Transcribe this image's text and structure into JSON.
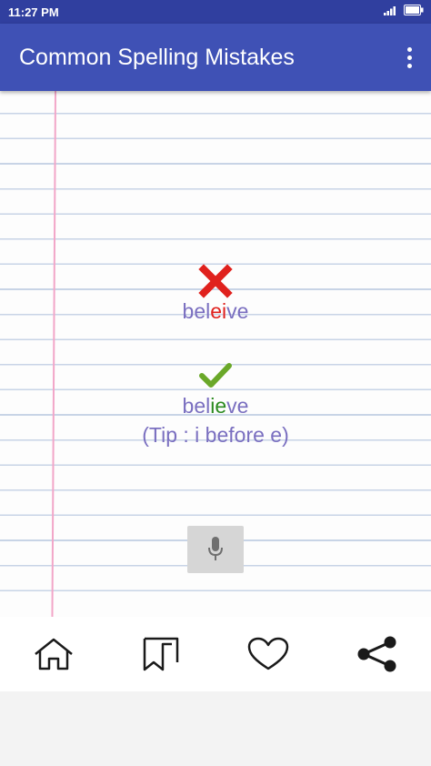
{
  "status_bar": {
    "time": "11:27 PM"
  },
  "app_bar": {
    "title": "Common Spelling Mistakes",
    "overflow_icon": "more-vert-icon"
  },
  "wrong": {
    "icon": "cross-icon",
    "color": "#e0211d",
    "prefix": "bel",
    "highlight": "ei",
    "suffix": "ve"
  },
  "correct": {
    "icon": "check-icon",
    "color": "#6aa829",
    "prefix": "bel",
    "highlight": "ie",
    "suffix": "ve"
  },
  "tip": "(Tip : i before e)",
  "mic_button": {
    "icon": "microphone-icon"
  },
  "bottom_nav": [
    {
      "icon": "home-icon"
    },
    {
      "icon": "bookmark-icon"
    },
    {
      "icon": "heart-icon"
    },
    {
      "icon": "share-icon"
    }
  ],
  "colors": {
    "primary": "#3f51b5",
    "primary_dark": "#303f9f",
    "word_text": "#7a6fc0",
    "wrong_highlight": "#e0211d",
    "correct_highlight": "#2b8a1f"
  }
}
